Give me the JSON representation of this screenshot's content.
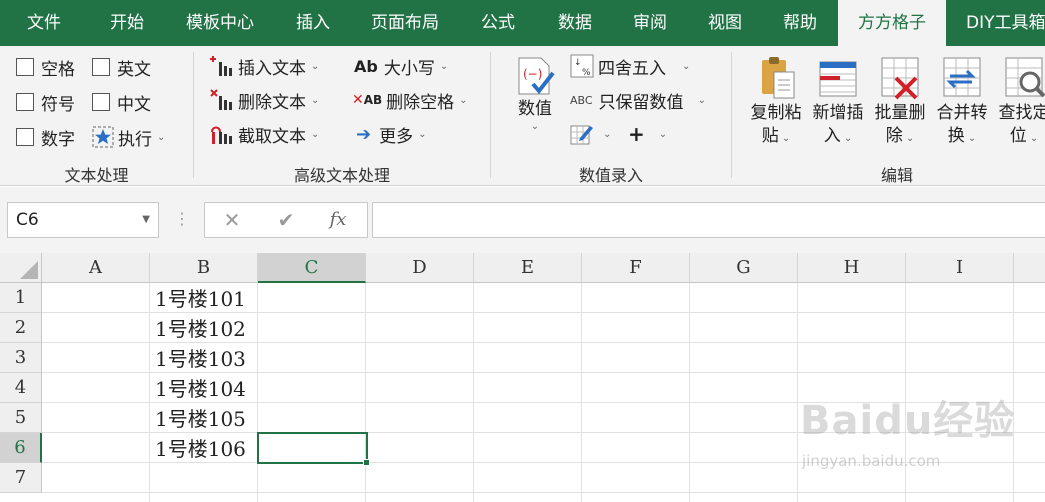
{
  "tabs": [
    "文件",
    "开始",
    "模板中心",
    "插入",
    "页面布局",
    "公式",
    "数据",
    "审阅",
    "视图",
    "帮助",
    "方方格子",
    "DIY工具箱"
  ],
  "ribbon": {
    "text_processing": {
      "items": [
        "空格",
        "英文",
        "符号",
        "中文",
        "数字",
        "执行"
      ],
      "group_label": "文本处理"
    },
    "advanced_text": {
      "items": [
        "插入文本",
        "删除文本",
        "截取文本",
        "大小写",
        "删除空格",
        "更多"
      ],
      "group_label": "高级文本处理"
    },
    "numeric_entry": {
      "big_button": "数值",
      "items": [
        "四舍五入",
        "只保留数值"
      ],
      "group_label": "数值录入"
    },
    "edit": {
      "buttons": [
        {
          "line1": "复制粘",
          "line2": "贴"
        },
        {
          "line1": "新增插",
          "line2": "入"
        },
        {
          "line1": "批量删",
          "line2": "除"
        },
        {
          "line1": "合并转",
          "line2": "换"
        },
        {
          "line1": "查找定",
          "line2": "位"
        }
      ],
      "group_label": "编辑"
    }
  },
  "formula_bar": {
    "name_box": "C6",
    "value": ""
  },
  "sheet": {
    "columns": [
      "A",
      "B",
      "C",
      "D",
      "E",
      "F",
      "G",
      "H",
      "I"
    ],
    "selected_column": "C",
    "rows": [
      "1",
      "2",
      "3",
      "4",
      "5",
      "6",
      "7"
    ],
    "selected_row": "6",
    "column_b_values": [
      "1号楼101",
      "1号楼102",
      "1号楼103",
      "1号楼104",
      "1号楼105",
      "1号楼106"
    ],
    "active_cell": "C6"
  },
  "watermark": {
    "logo_text": "Baidu经验",
    "url": "jingyan.baidu.com"
  },
  "colors": {
    "accent": "#217346",
    "ribbon_bg": "#f3f3f3",
    "header_bg": "#efefef"
  }
}
